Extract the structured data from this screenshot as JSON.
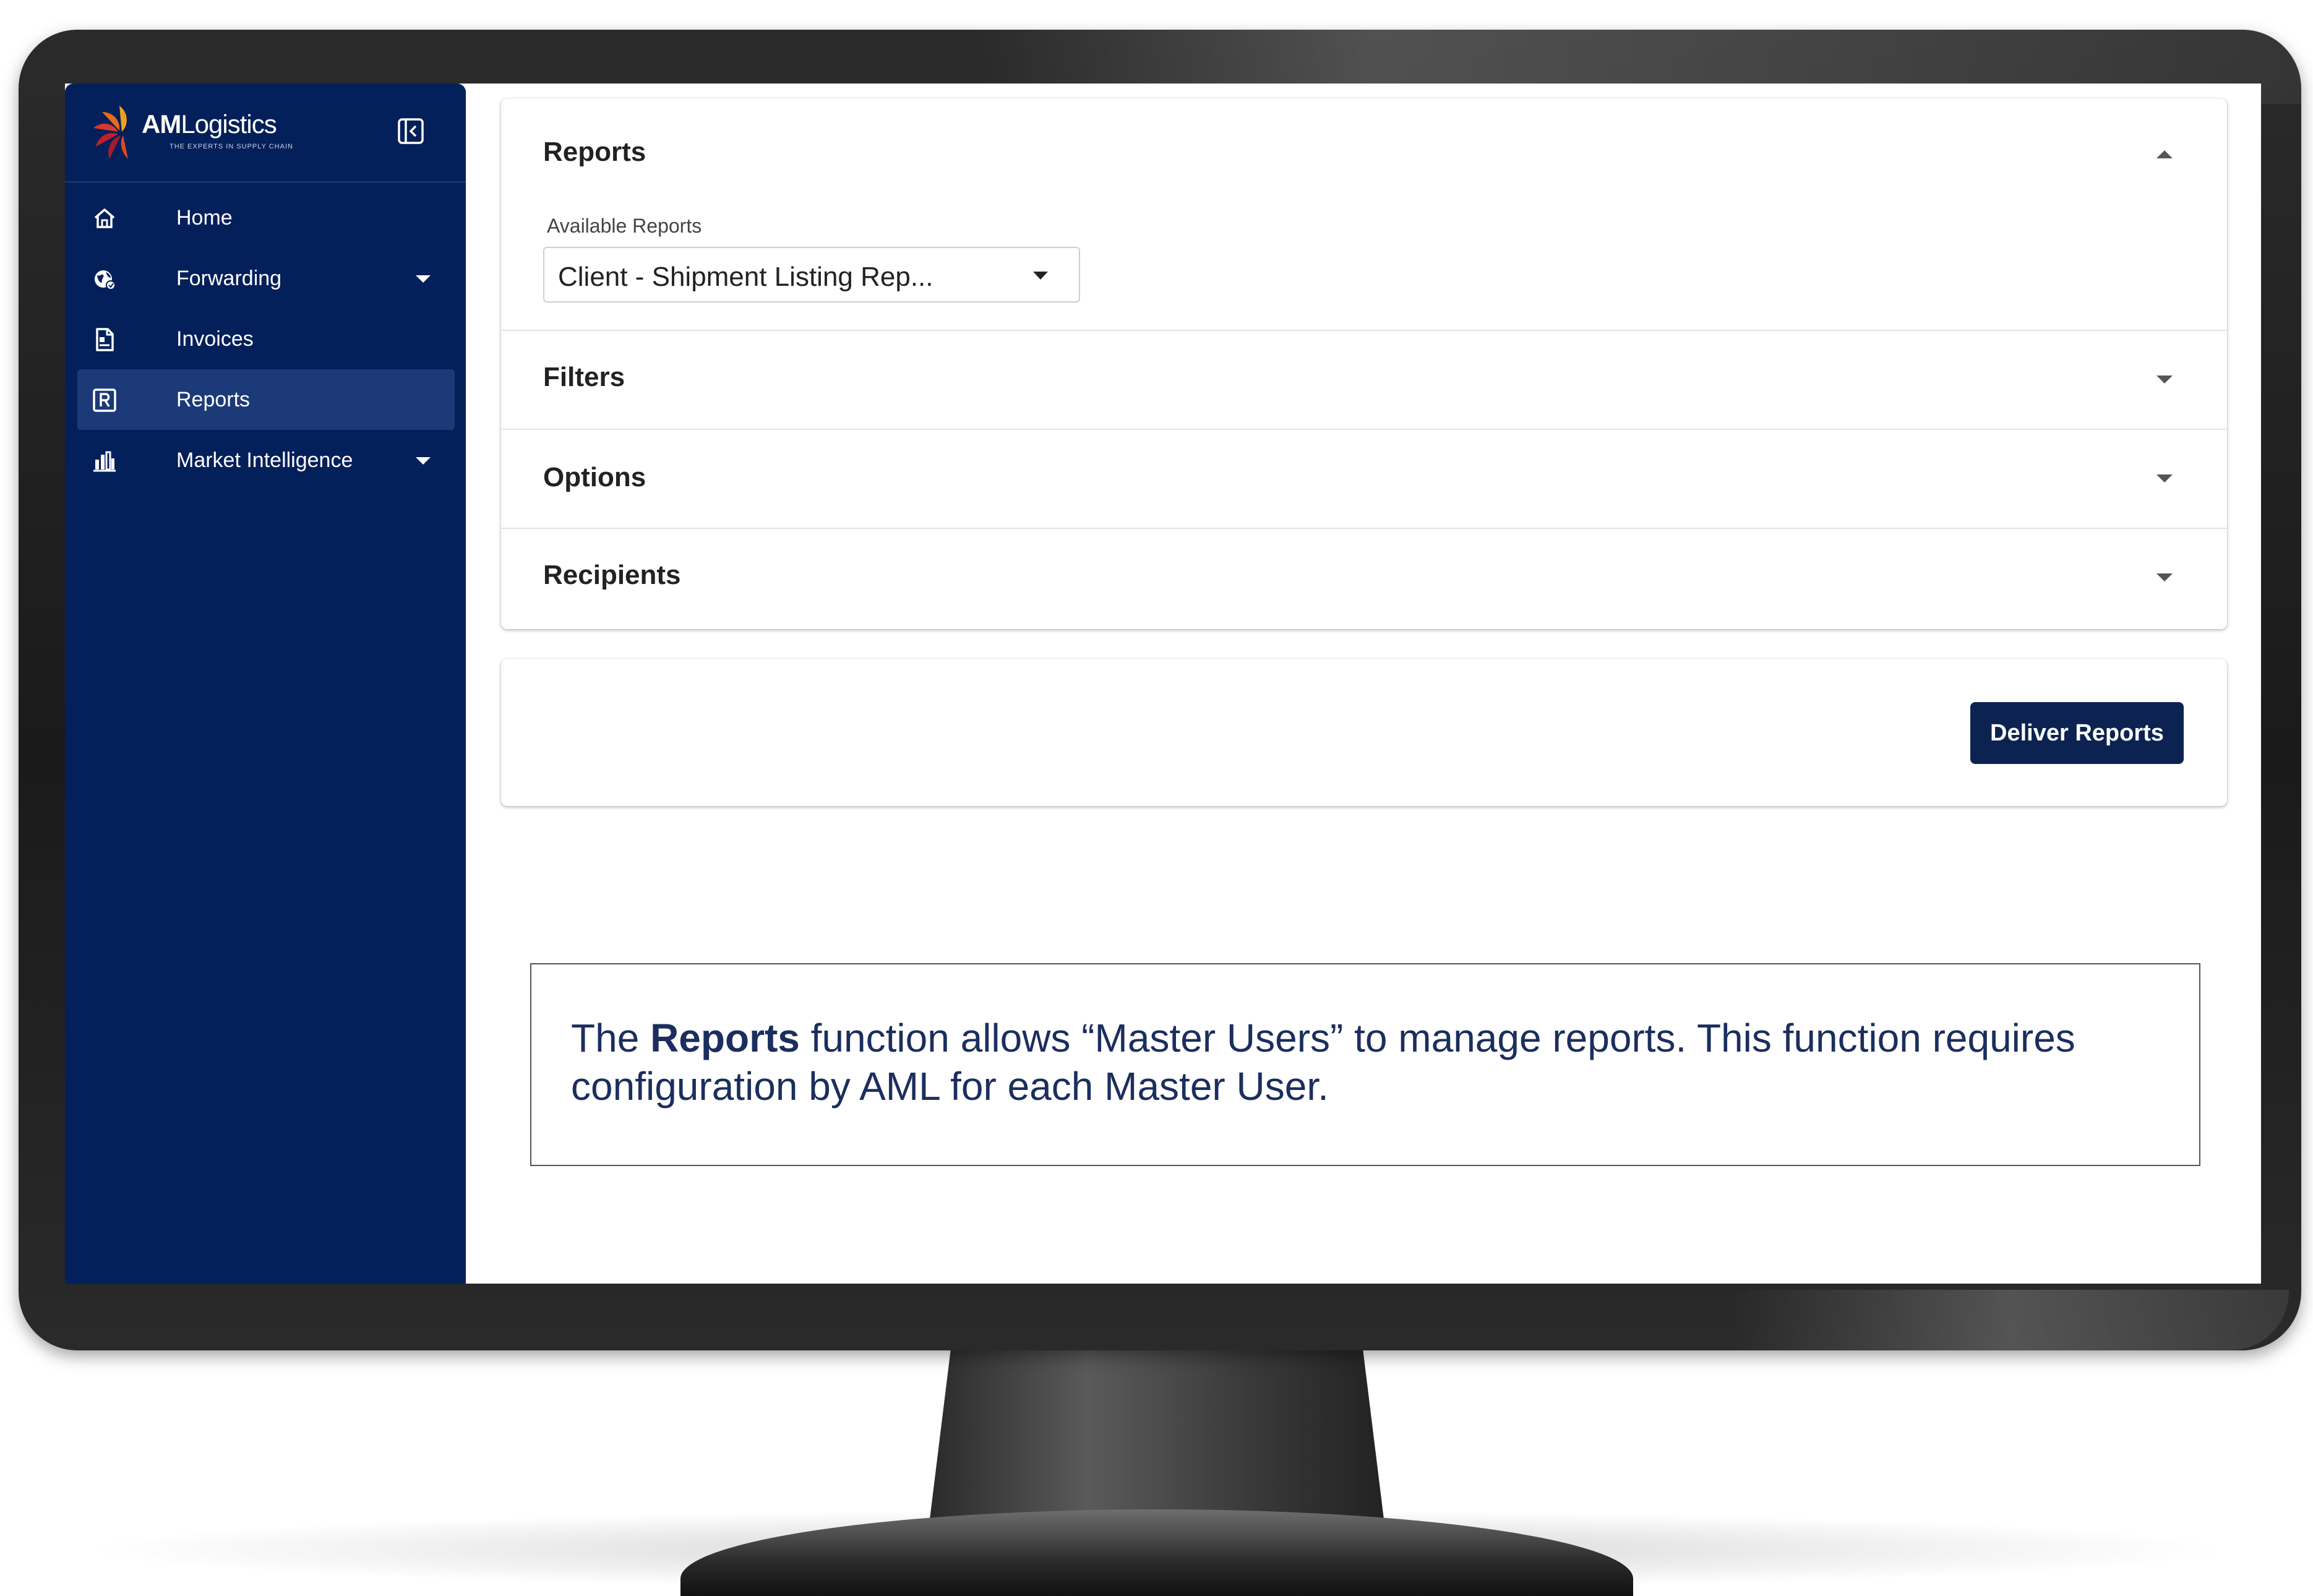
{
  "sidebar": {
    "logo": {
      "brand_bold": "AM",
      "brand_light": "Logistics",
      "tagline": "THE EXPERTS IN SUPPLY CHAIN"
    },
    "collapse_icon": "collapse-sidebar-icon",
    "items": [
      {
        "label": "Home",
        "icon": "home-icon",
        "has_caret": false,
        "active": false
      },
      {
        "label": "Forwarding",
        "icon": "globe-icon",
        "has_caret": true,
        "active": false
      },
      {
        "label": "Invoices",
        "icon": "invoice-icon",
        "has_caret": false,
        "active": false
      },
      {
        "label": "Reports",
        "icon": "reports-icon",
        "has_caret": false,
        "active": true
      },
      {
        "label": "Market Intelligence",
        "icon": "bar-chart-icon",
        "has_caret": true,
        "active": false
      }
    ]
  },
  "reports_panel": {
    "title": "Reports",
    "available_reports_label": "Available Reports",
    "selected_report": "Client - Shipment Listing Rep..."
  },
  "accordions": {
    "filters": "Filters",
    "options": "Options",
    "recipients": "Recipients"
  },
  "actions": {
    "deliver_label": "Deliver Reports"
  },
  "callout": {
    "prefix": "The ",
    "bold": "Reports",
    "suffix": " function allows “Master Users” to manage reports.  This function requires configuration by AML for each Master User."
  },
  "colors": {
    "sidebar_bg": "#04205a",
    "sidebar_active": "#1c3a78",
    "button_bg": "#0c2352",
    "callout_text": "#1b2e5e"
  }
}
